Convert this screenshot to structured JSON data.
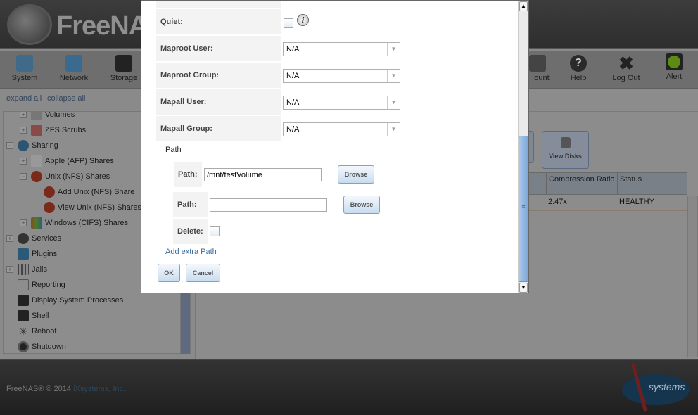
{
  "header": {
    "logo_text": "FreeNAS"
  },
  "toolbar": {
    "items": [
      {
        "label": "System",
        "icon": "system-icon"
      },
      {
        "label": "Network",
        "icon": "network-icon"
      },
      {
        "label": "Storage",
        "icon": "storage-icon"
      },
      {
        "label": "ount",
        "icon": "account-icon"
      },
      {
        "label": "Help",
        "icon": "help-icon"
      },
      {
        "label": "Log Out",
        "icon": "logout-icon"
      },
      {
        "label": "Alert",
        "icon": "alert-icon"
      }
    ]
  },
  "sidebar": {
    "expand_all": "expand all",
    "collapse_all": "collapse all",
    "items": [
      {
        "label": "Volumes"
      },
      {
        "label": "ZFS Scrubs"
      },
      {
        "label": "Sharing"
      },
      {
        "label": "Apple (AFP) Shares"
      },
      {
        "label": "Unix (NFS) Shares"
      },
      {
        "label": "Add Unix (NFS) Share"
      },
      {
        "label": "View Unix (NFS) Shares"
      },
      {
        "label": "Windows (CIFS) Shares"
      },
      {
        "label": "Services"
      },
      {
        "label": "Plugins"
      },
      {
        "label": "Jails"
      },
      {
        "label": "Reporting"
      },
      {
        "label": "Display System Processes"
      },
      {
        "label": "Shell"
      },
      {
        "label": "Reboot"
      },
      {
        "label": "Shutdown"
      }
    ]
  },
  "content": {
    "view_disks": "View Disks",
    "table": {
      "headers": [
        "Compression Ratio",
        "Status"
      ],
      "rows": [
        [
          "2.47x",
          "HEALTHY"
        ]
      ]
    }
  },
  "modal": {
    "quiet_label": "Quiet:",
    "maproot_user_label": "Maproot User:",
    "maproot_user_value": "N/A",
    "maproot_group_label": "Maproot Group:",
    "maproot_group_value": "N/A",
    "mapall_user_label": "Mapall User:",
    "mapall_user_value": "N/A",
    "mapall_group_label": "Mapall Group:",
    "mapall_group_value": "N/A",
    "path_section": "Path",
    "path1_label": "Path:",
    "path1_value": "/mnt/testVolume",
    "path2_label": "Path:",
    "path2_value": "",
    "browse": "Browse",
    "delete_label": "Delete:",
    "add_extra_path": "Add extra Path",
    "ok": "OK",
    "cancel": "Cancel"
  },
  "footer": {
    "copyright": "FreeNAS® © 2014 ",
    "company": "iXsystems, Inc.",
    "logo_text": "systems"
  }
}
